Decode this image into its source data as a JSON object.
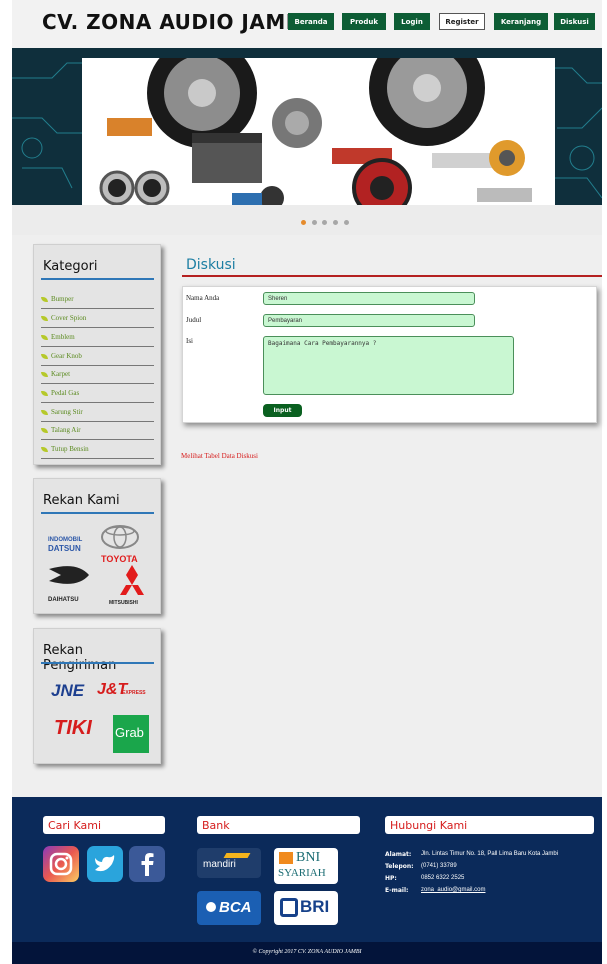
{
  "header": {
    "title": "CV. ZONA AUDIO JAMBI",
    "nav": [
      "Beranda",
      "Produk",
      "Login",
      "Register",
      "Keranjang",
      "Diskusi"
    ],
    "active_nav": "Register"
  },
  "slider": {
    "dot_count": 5,
    "active_dot": 1
  },
  "sidebar": {
    "kategori": {
      "title": "Kategori",
      "items": [
        "Bumper",
        "Cover Spion",
        "Emblem",
        "Gear Knob",
        "Karpet",
        "Pedal Gas",
        "Sarung Stir",
        "Talang Air",
        "Tutup Bensin"
      ]
    },
    "rekan": {
      "title": "Rekan Kami",
      "logos": [
        "INDOMOBIL",
        "DATSUN",
        "TOYOTA",
        "DAIHATSU",
        "MITSUBISHI"
      ]
    },
    "pengiriman": {
      "title": "Rekan Pengiriman",
      "logos": [
        "JNE",
        "J&T",
        "EXPRESS",
        "TIKI",
        "Grab"
      ]
    }
  },
  "main": {
    "title": "Diskusi",
    "form": {
      "nama_label": "Nama Anda",
      "nama_value": "Sheren",
      "judul_label": "Judul",
      "judul_value": "Pembayaran",
      "isi_label": "Isi",
      "isi_value": "Bagaimana Cara Pembayarannya ?",
      "submit": "Input"
    },
    "link": "Melihat Tabel Data Diskusi"
  },
  "footer": {
    "cari_kami": "Cari Kami",
    "bank": "Bank",
    "hubungi": "Hubungi Kami",
    "banks": [
      "mandiri",
      "BNI",
      "SYARIAH",
      "BCA",
      "BRI"
    ],
    "contact": [
      {
        "key": "Alamat:",
        "value": "Jln. Lintas Timur No. 18, Pall Lima Baru Kota Jambi"
      },
      {
        "key": "Telepon:",
        "value": "(0741) 33789"
      },
      {
        "key": "HP:",
        "value": "0852 6322 2525"
      },
      {
        "key": "E-mail:",
        "value": "zona_audio@gmail.com"
      }
    ],
    "copyright": "© Copyright 2017 CV. ZONA AUDIO JAMBI"
  }
}
